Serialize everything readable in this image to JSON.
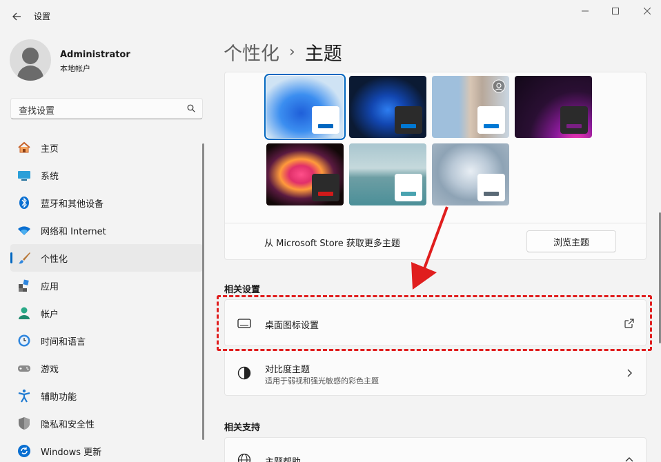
{
  "window": {
    "title": "设置"
  },
  "profile": {
    "name": "Administrator",
    "type": "本地帐户"
  },
  "search": {
    "placeholder": "查找设置"
  },
  "nav": [
    {
      "label": "主页",
      "icon": "home-icon",
      "active": false
    },
    {
      "label": "系统",
      "icon": "system-icon",
      "active": false
    },
    {
      "label": "蓝牙和其他设备",
      "icon": "bluetooth-icon",
      "active": false
    },
    {
      "label": "网络和 Internet",
      "icon": "wifi-icon",
      "active": false
    },
    {
      "label": "个性化",
      "icon": "brush-icon",
      "active": true
    },
    {
      "label": "应用",
      "icon": "apps-icon",
      "active": false
    },
    {
      "label": "帐户",
      "icon": "account-icon",
      "active": false
    },
    {
      "label": "时间和语言",
      "icon": "clock-globe-icon",
      "active": false
    },
    {
      "label": "游戏",
      "icon": "gamepad-icon",
      "active": false
    },
    {
      "label": "辅助功能",
      "icon": "accessibility-icon",
      "active": false
    },
    {
      "label": "隐私和安全性",
      "icon": "shield-icon",
      "active": false
    },
    {
      "label": "Windows 更新",
      "icon": "update-icon",
      "active": false
    }
  ],
  "breadcrumb": {
    "parent": "个性化",
    "separator": "›",
    "current": "主题"
  },
  "themes": {
    "tiles": [
      {
        "name": "windows-light",
        "bg": "#cfe3f4",
        "accent": "#0067c0",
        "chip": "#ffffff",
        "selected": true
      },
      {
        "name": "windows-dark",
        "bg": "#0b1a33",
        "accent": "#0078d4",
        "chip": "#2b2b2b",
        "selected": false
      },
      {
        "name": "glow",
        "bg": "#8fb6d8",
        "accent": "#0078d4",
        "chip": "#ffffff",
        "selected": false
      },
      {
        "name": "captured-motion",
        "bg": "#2a0f33",
        "accent": "#7a1f83",
        "chip": "#2b2b2b",
        "selected": false
      },
      {
        "name": "flow",
        "bg": "#1a1010",
        "accent": "#d11a1a",
        "chip": "#2b2b2b",
        "selected": false
      },
      {
        "name": "sunrise",
        "bg": "#6fa3b0",
        "accent": "#4aa3b0",
        "chip": "#ffffff",
        "selected": false
      },
      {
        "name": "bloom",
        "bg": "#a8b8c6",
        "accent": "#5a6a76",
        "chip": "#ffffff",
        "selected": false
      }
    ],
    "store_text": "从 Microsoft Store 获取更多主题",
    "browse_label": "浏览主题"
  },
  "related_settings": {
    "heading": "相关设置",
    "desktop_icons": {
      "title": "桌面图标设置"
    },
    "contrast": {
      "title": "对比度主题",
      "subtitle": "适用于弱视和强光敏感的彩色主题"
    }
  },
  "related_support": {
    "heading": "相关支持",
    "help": {
      "title": "主题帮助"
    }
  },
  "colors": {
    "accent": "#0067c0",
    "annotation": "#e01e1e"
  }
}
